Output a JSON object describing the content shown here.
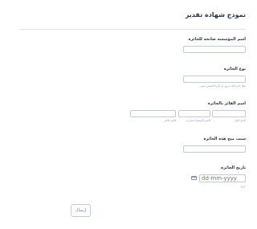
{
  "form": {
    "title": "نموذج شهادة تقدير",
    "fields": {
      "organization": {
        "label": "اسم المؤسسة صانحة للجائزة",
        "value": ""
      },
      "award_type": {
        "label": "نوع الجائزة",
        "value": "",
        "hint": "مثلاً: جائزة قائد فريق، أو جائزة الشخص متميز"
      },
      "recipient": {
        "label": "اسم الفائز بالجائزة",
        "first_name": {
          "value": "",
          "sublabel": "الاسم الأول"
        },
        "middle_name": {
          "value": "",
          "sublabel": "الاسم الأوسط (اختياري)"
        },
        "last_name": {
          "value": "",
          "sublabel": "الاسم الأخير"
        }
      },
      "reason": {
        "label": "سبب منح هذه الجائزة",
        "value": ""
      },
      "award_date": {
        "label": "تاريخ الجائزة",
        "placeholder": "dd-mm-yyyy",
        "sublabel": "تاريخ",
        "icon": "calendar-icon"
      }
    },
    "submit_label": "إرسال"
  }
}
